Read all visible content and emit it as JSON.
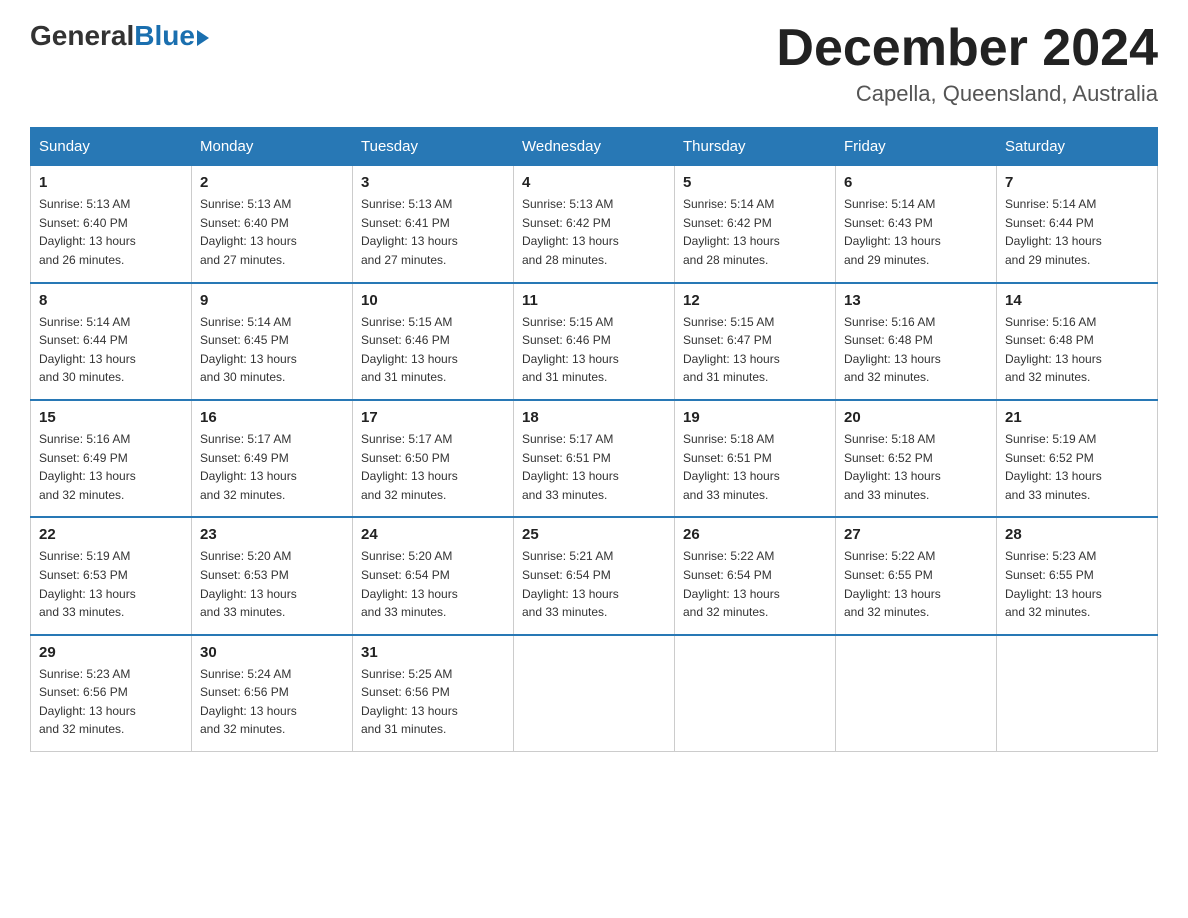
{
  "header": {
    "logo_general": "General",
    "logo_blue": "Blue",
    "month_title": "December 2024",
    "location": "Capella, Queensland, Australia"
  },
  "days_of_week": [
    "Sunday",
    "Monday",
    "Tuesday",
    "Wednesday",
    "Thursday",
    "Friday",
    "Saturday"
  ],
  "weeks": [
    [
      {
        "day": "1",
        "sunrise": "5:13 AM",
        "sunset": "6:40 PM",
        "daylight": "13 hours and 26 minutes."
      },
      {
        "day": "2",
        "sunrise": "5:13 AM",
        "sunset": "6:40 PM",
        "daylight": "13 hours and 27 minutes."
      },
      {
        "day": "3",
        "sunrise": "5:13 AM",
        "sunset": "6:41 PM",
        "daylight": "13 hours and 27 minutes."
      },
      {
        "day": "4",
        "sunrise": "5:13 AM",
        "sunset": "6:42 PM",
        "daylight": "13 hours and 28 minutes."
      },
      {
        "day": "5",
        "sunrise": "5:14 AM",
        "sunset": "6:42 PM",
        "daylight": "13 hours and 28 minutes."
      },
      {
        "day": "6",
        "sunrise": "5:14 AM",
        "sunset": "6:43 PM",
        "daylight": "13 hours and 29 minutes."
      },
      {
        "day": "7",
        "sunrise": "5:14 AM",
        "sunset": "6:44 PM",
        "daylight": "13 hours and 29 minutes."
      }
    ],
    [
      {
        "day": "8",
        "sunrise": "5:14 AM",
        "sunset": "6:44 PM",
        "daylight": "13 hours and 30 minutes."
      },
      {
        "day": "9",
        "sunrise": "5:14 AM",
        "sunset": "6:45 PM",
        "daylight": "13 hours and 30 minutes."
      },
      {
        "day": "10",
        "sunrise": "5:15 AM",
        "sunset": "6:46 PM",
        "daylight": "13 hours and 31 minutes."
      },
      {
        "day": "11",
        "sunrise": "5:15 AM",
        "sunset": "6:46 PM",
        "daylight": "13 hours and 31 minutes."
      },
      {
        "day": "12",
        "sunrise": "5:15 AM",
        "sunset": "6:47 PM",
        "daylight": "13 hours and 31 minutes."
      },
      {
        "day": "13",
        "sunrise": "5:16 AM",
        "sunset": "6:48 PM",
        "daylight": "13 hours and 32 minutes."
      },
      {
        "day": "14",
        "sunrise": "5:16 AM",
        "sunset": "6:48 PM",
        "daylight": "13 hours and 32 minutes."
      }
    ],
    [
      {
        "day": "15",
        "sunrise": "5:16 AM",
        "sunset": "6:49 PM",
        "daylight": "13 hours and 32 minutes."
      },
      {
        "day": "16",
        "sunrise": "5:17 AM",
        "sunset": "6:49 PM",
        "daylight": "13 hours and 32 minutes."
      },
      {
        "day": "17",
        "sunrise": "5:17 AM",
        "sunset": "6:50 PM",
        "daylight": "13 hours and 32 minutes."
      },
      {
        "day": "18",
        "sunrise": "5:17 AM",
        "sunset": "6:51 PM",
        "daylight": "13 hours and 33 minutes."
      },
      {
        "day": "19",
        "sunrise": "5:18 AM",
        "sunset": "6:51 PM",
        "daylight": "13 hours and 33 minutes."
      },
      {
        "day": "20",
        "sunrise": "5:18 AM",
        "sunset": "6:52 PM",
        "daylight": "13 hours and 33 minutes."
      },
      {
        "day": "21",
        "sunrise": "5:19 AM",
        "sunset": "6:52 PM",
        "daylight": "13 hours and 33 minutes."
      }
    ],
    [
      {
        "day": "22",
        "sunrise": "5:19 AM",
        "sunset": "6:53 PM",
        "daylight": "13 hours and 33 minutes."
      },
      {
        "day": "23",
        "sunrise": "5:20 AM",
        "sunset": "6:53 PM",
        "daylight": "13 hours and 33 minutes."
      },
      {
        "day": "24",
        "sunrise": "5:20 AM",
        "sunset": "6:54 PM",
        "daylight": "13 hours and 33 minutes."
      },
      {
        "day": "25",
        "sunrise": "5:21 AM",
        "sunset": "6:54 PM",
        "daylight": "13 hours and 33 minutes."
      },
      {
        "day": "26",
        "sunrise": "5:22 AM",
        "sunset": "6:54 PM",
        "daylight": "13 hours and 32 minutes."
      },
      {
        "day": "27",
        "sunrise": "5:22 AM",
        "sunset": "6:55 PM",
        "daylight": "13 hours and 32 minutes."
      },
      {
        "day": "28",
        "sunrise": "5:23 AM",
        "sunset": "6:55 PM",
        "daylight": "13 hours and 32 minutes."
      }
    ],
    [
      {
        "day": "29",
        "sunrise": "5:23 AM",
        "sunset": "6:56 PM",
        "daylight": "13 hours and 32 minutes."
      },
      {
        "day": "30",
        "sunrise": "5:24 AM",
        "sunset": "6:56 PM",
        "daylight": "13 hours and 32 minutes."
      },
      {
        "day": "31",
        "sunrise": "5:25 AM",
        "sunset": "6:56 PM",
        "daylight": "13 hours and 31 minutes."
      },
      null,
      null,
      null,
      null
    ]
  ],
  "labels": {
    "sunrise": "Sunrise:",
    "sunset": "Sunset:",
    "daylight": "Daylight:"
  }
}
